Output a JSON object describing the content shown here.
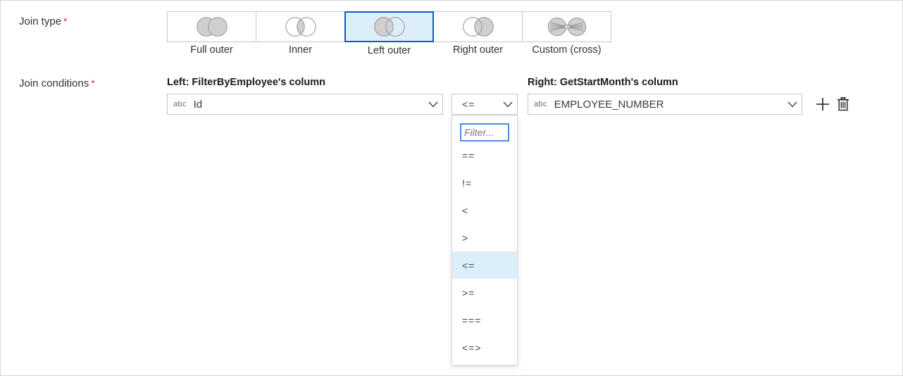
{
  "form": {
    "join_type_label": "Join type",
    "join_conditions_label": "Join conditions",
    "required_marker": "*"
  },
  "join_types": {
    "selected": "Left outer",
    "options": [
      {
        "id": "full-outer",
        "label": "Full outer",
        "icon": "venn-full-outer-icon",
        "selected": false
      },
      {
        "id": "inner",
        "label": "Inner",
        "icon": "venn-inner-icon",
        "selected": false
      },
      {
        "id": "left-outer",
        "label": "Left outer",
        "icon": "venn-left-outer-icon",
        "selected": true
      },
      {
        "id": "right-outer",
        "label": "Right outer",
        "icon": "venn-right-outer-icon",
        "selected": false
      },
      {
        "id": "custom-cross",
        "label": "Custom (cross)",
        "icon": "venn-custom-cross-icon",
        "selected": false
      }
    ]
  },
  "join_conditions": {
    "left_header": "Left: FilterByEmployee's column",
    "right_header": "Right: GetStartMonth's column",
    "left_column": {
      "type_icon": "abc",
      "value": "Id"
    },
    "right_column": {
      "type_icon": "abc",
      "value": "EMPLOYEE_NUMBER"
    },
    "operator": {
      "value": "<=",
      "dropdown_open": true,
      "filter_placeholder": "Filter...",
      "filter_value": "",
      "options": [
        {
          "label": "==",
          "selected": false
        },
        {
          "label": "!=",
          "selected": false
        },
        {
          "label": "<",
          "selected": false
        },
        {
          "label": ">",
          "selected": false
        },
        {
          "label": "<=",
          "selected": true
        },
        {
          "label": ">=",
          "selected": false
        },
        {
          "label": "===",
          "selected": false
        },
        {
          "label": "<=>",
          "selected": false
        }
      ]
    },
    "add_button": "add-condition",
    "delete_button": "delete-condition"
  },
  "colors": {
    "accent": "#0b5bc4",
    "selected_fill": "#ddeefb",
    "required": "#d13438",
    "border": "#c8c8c8",
    "venn_fill": "#d0d0d0",
    "venn_stroke": "#9a9a9a"
  }
}
